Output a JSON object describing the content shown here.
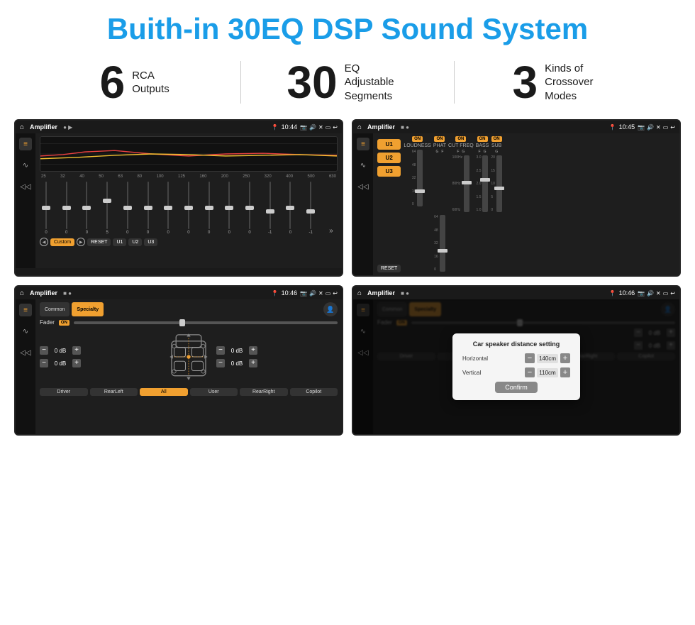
{
  "page": {
    "title": "Buith-in 30EQ DSP Sound System"
  },
  "stats": [
    {
      "number": "6",
      "label": "RCA\nOutputs"
    },
    {
      "number": "30",
      "label": "EQ Adjustable\nSegments"
    },
    {
      "number": "3",
      "label": "Kinds of\nCrossover Modes"
    }
  ],
  "screens": {
    "screen1": {
      "title": "Amplifier",
      "time": "10:44",
      "frequencies": [
        "25",
        "32",
        "40",
        "50",
        "63",
        "80",
        "100",
        "125",
        "160",
        "200",
        "250",
        "320",
        "400",
        "500",
        "630"
      ],
      "sliderValues": [
        "0",
        "0",
        "0",
        "5",
        "0",
        "0",
        "0",
        "0",
        "0",
        "0",
        "0",
        "-1",
        "0",
        "-1"
      ],
      "presets": [
        "Custom",
        "RESET",
        "U1",
        "U2",
        "U3"
      ]
    },
    "screen2": {
      "title": "Amplifier",
      "time": "10:45",
      "uPresets": [
        "U1",
        "U2",
        "U3"
      ],
      "channels": [
        "LOUDNESS",
        "PHAT",
        "CUT FREQ",
        "BASS",
        "SUB"
      ],
      "resetLabel": "RESET"
    },
    "screen3": {
      "title": "Amplifier",
      "time": "10:46",
      "tabs": [
        "Common",
        "Specialty"
      ],
      "faderLabel": "Fader",
      "dbValues": [
        "0 dB",
        "0 dB",
        "0 dB",
        "0 dB"
      ],
      "bottomBtns": [
        "Driver",
        "RearLeft",
        "All",
        "User",
        "RearRight",
        "Copilot"
      ]
    },
    "screen4": {
      "title": "Amplifier",
      "time": "10:46",
      "tabs": [
        "Common",
        "Specialty"
      ],
      "dialog": {
        "title": "Car speaker distance setting",
        "fields": [
          {
            "label": "Horizontal",
            "value": "140cm"
          },
          {
            "label": "Vertical",
            "value": "110cm"
          }
        ],
        "confirmLabel": "Confirm"
      },
      "dbValues": [
        "0 dB",
        "0 dB"
      ],
      "bottomBtns": [
        "Driver",
        "RearLef...",
        "User",
        "RearRight",
        "Copilot"
      ]
    }
  },
  "colors": {
    "accent": "#f0a030",
    "titleBlue": "#1a9de8",
    "dark": "#1a1a1a",
    "statusBar": "#1a1a1a"
  }
}
